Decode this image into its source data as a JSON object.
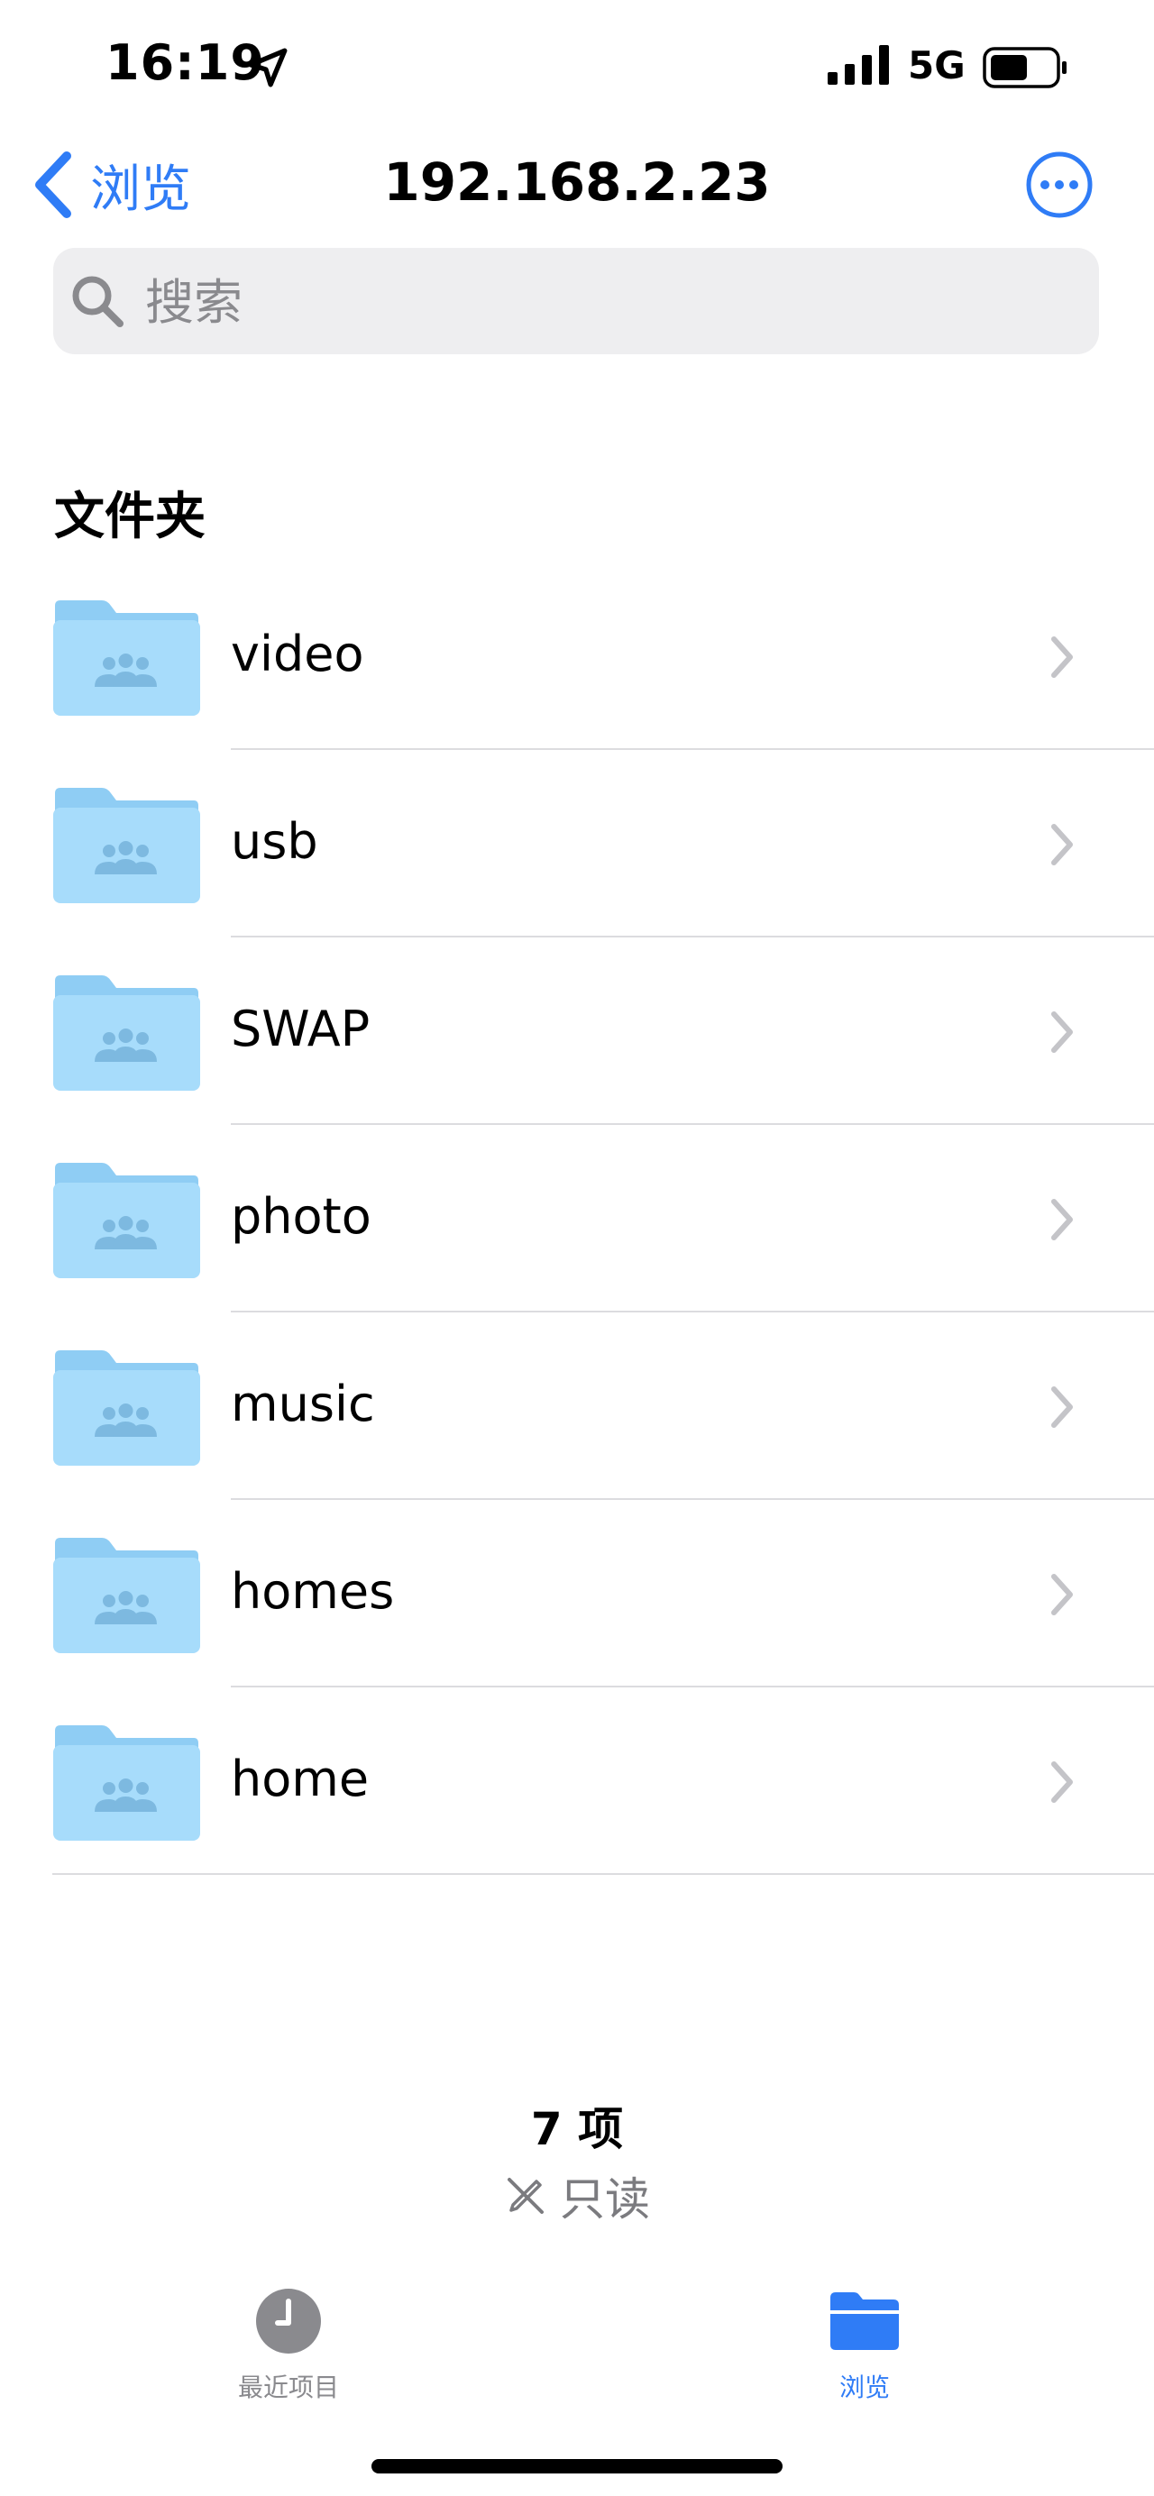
{
  "status_bar": {
    "time": "16:19",
    "network": "5G",
    "icons": [
      "location-arrow-icon",
      "signal-bars-icon",
      "battery-icon"
    ]
  },
  "nav": {
    "back_label": "浏览",
    "title": "192.168.2.23",
    "more_icon": "ellipsis-circle-icon"
  },
  "search": {
    "placeholder": "搜索",
    "value": ""
  },
  "section": {
    "title": "文件夹"
  },
  "folders": [
    {
      "name": "video"
    },
    {
      "name": "usb"
    },
    {
      "name": "SWAP"
    },
    {
      "name": "photo"
    },
    {
      "name": "music"
    },
    {
      "name": "homes"
    },
    {
      "name": "home"
    }
  ],
  "footer": {
    "item_count": "7 项",
    "readonly_label": "只读"
  },
  "tabs": [
    {
      "label": "最近项目",
      "icon": "clock-icon",
      "active": false
    },
    {
      "label": "浏览",
      "icon": "folder-icon",
      "active": true
    }
  ],
  "colors": {
    "accent": "#2f7cf6",
    "folder_light": "#a7dcfb",
    "folder_dark": "#8fcdf4",
    "secondary_text": "#8a8a8e"
  }
}
